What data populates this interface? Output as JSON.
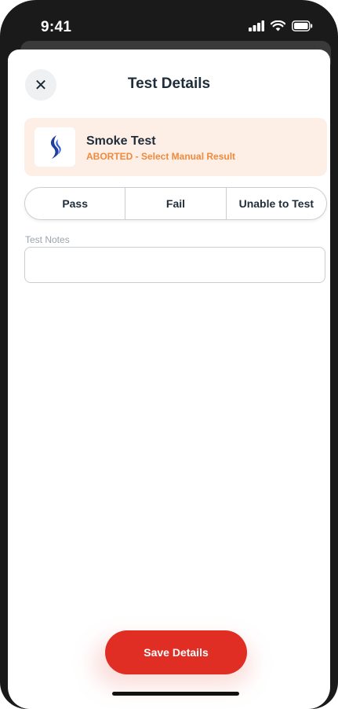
{
  "status_bar": {
    "time": "9:41"
  },
  "header": {
    "title": "Test Details",
    "close_glyph": "✕"
  },
  "test_card": {
    "name": "Smoke Test",
    "status": "ABORTED - Select Manual Result",
    "logo_icon": "flame-logo-icon",
    "status_color": "#f08a3c"
  },
  "result_options": [
    {
      "label": "Pass"
    },
    {
      "label": "Fail"
    },
    {
      "label": "Unable to Test"
    }
  ],
  "notes": {
    "label": "Test Notes",
    "value": "",
    "placeholder": ""
  },
  "footer": {
    "save_label": "Save Details",
    "save_color": "#e02e24"
  }
}
